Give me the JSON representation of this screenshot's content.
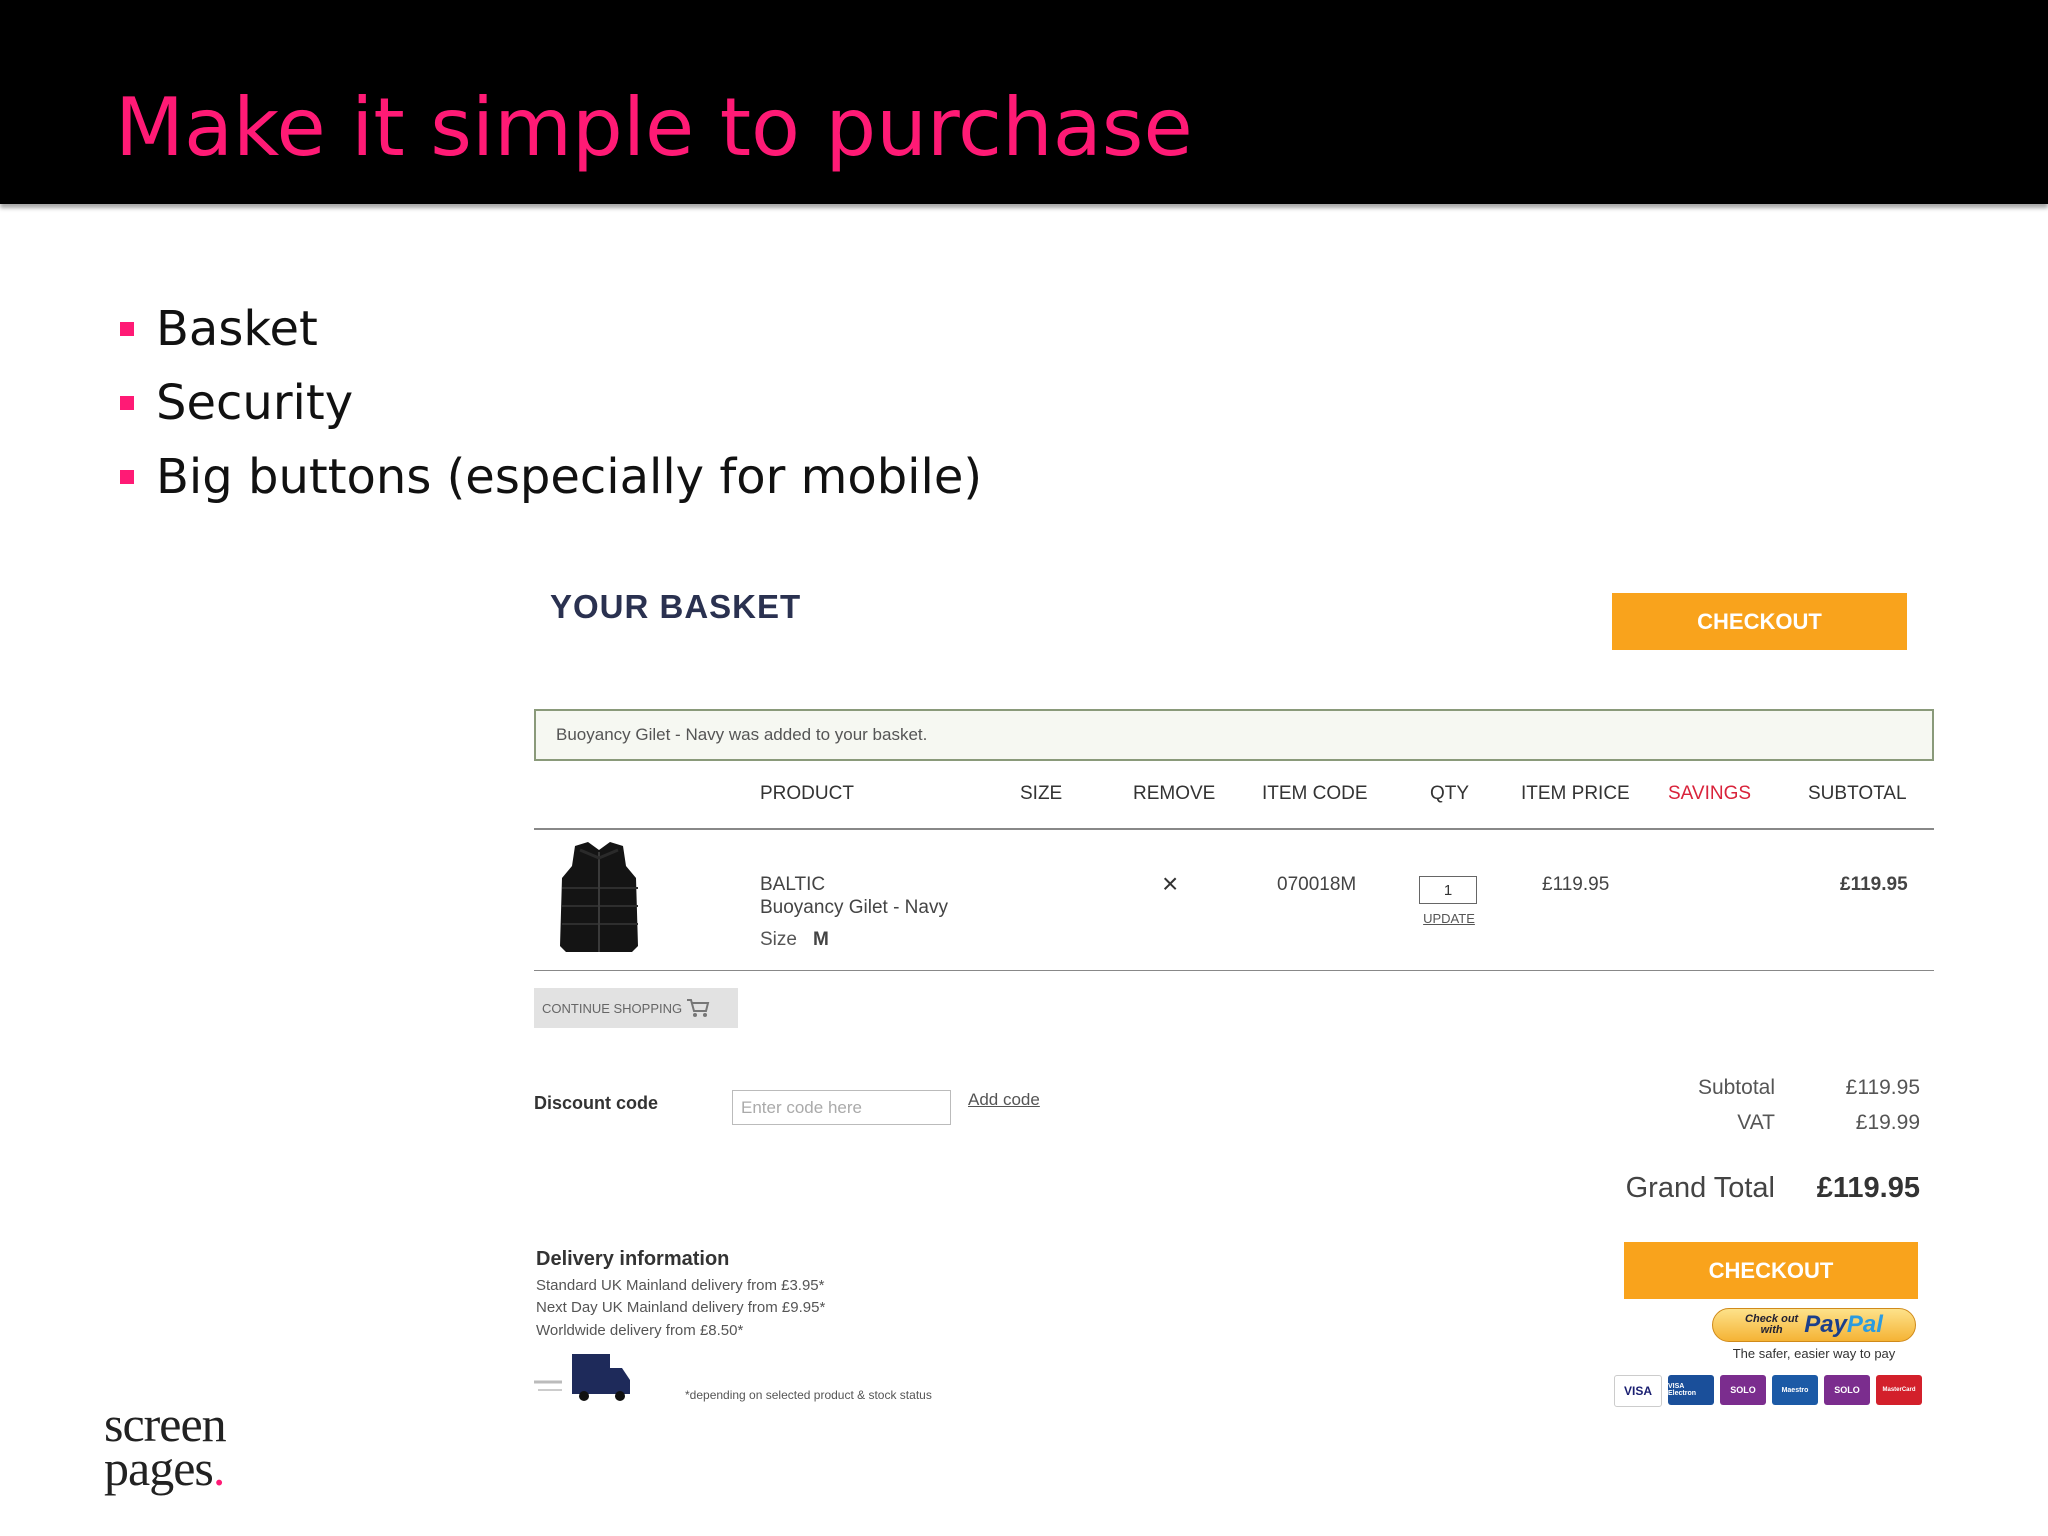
{
  "slide": {
    "title": "Make it simple to purchase",
    "bullets": [
      "Basket",
      "Security",
      "Big buttons (especially for mobile)"
    ]
  },
  "basket": {
    "title": "YOUR BASKET",
    "checkout_label": "CHECKOUT",
    "notice": "Buoyancy Gilet - Navy was added to your basket.",
    "columns": [
      "PRODUCT",
      "SIZE",
      "REMOVE",
      "ITEM CODE",
      "QTY",
      "ITEM PRICE",
      "SAVINGS",
      "SUBTOTAL"
    ],
    "savings_color": "#d9233b",
    "item": {
      "brand": "BALTIC",
      "name": "Buoyancy Gilet - Navy",
      "size_label": "Size",
      "size_value": "M",
      "remove_icon": "×",
      "code": "070018M",
      "qty": "1",
      "update_label": "UPDATE",
      "price": "£119.95",
      "subtotal": "£119.95"
    },
    "continue_label": "CONTINUE SHOPPING",
    "discount": {
      "label": "Discount code",
      "placeholder": "Enter code here",
      "add_label": "Add code"
    },
    "summary": {
      "subtotal_label": "Subtotal",
      "subtotal_value": "£119.95",
      "vat_label": "VAT",
      "vat_value": "£19.99",
      "grand_label": "Grand Total",
      "grand_value": "£119.95"
    },
    "paypal": {
      "check_out": "Check out",
      "with": "with",
      "pay": "Pay",
      "pal": "Pal",
      "tagline": "The safer, easier way to pay"
    },
    "cards": [
      "VISA",
      "VISA Electron",
      "SOLO",
      "Maestro",
      "SOLO",
      "MasterCard"
    ],
    "delivery": {
      "title": "Delivery information",
      "lines": [
        "Standard UK Mainland delivery from £3.95*",
        "Next Day UK Mainland delivery from £9.95*",
        "Worldwide delivery from £8.50*"
      ],
      "note": "*depending on selected product & stock status"
    },
    "accent": "#f9a31c"
  },
  "logo": {
    "line1": "screen",
    "line2": "pages",
    "dot": "."
  }
}
